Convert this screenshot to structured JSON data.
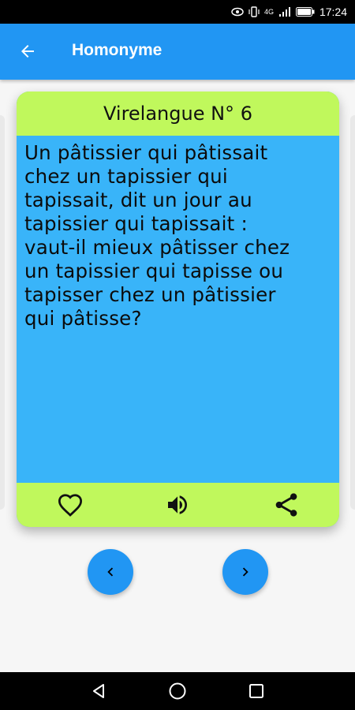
{
  "status_bar": {
    "time": "17:24",
    "network": "4G",
    "icons": [
      "eye-icon",
      "vibrate-icon",
      "signal-icon",
      "battery-icon"
    ]
  },
  "app_bar": {
    "title": "Homonyme",
    "back_icon": "arrow-back-icon"
  },
  "card": {
    "title": "Virelangue N° 6",
    "lines": [
      "Un pâtissier qui pâtissait",
      "chez un tapissier qui",
      "tapissait, dit un jour au",
      "tapissier qui tapissait :",
      "vaut-il mieux pâtisser chez",
      "un tapissier qui tapisse ou",
      "tapisser chez un pâtissier",
      "qui pâtisse?"
    ],
    "actions": [
      "favorite-icon",
      "volume-icon",
      "share-icon"
    ]
  },
  "navigation": {
    "previous_icon": "chevron-left-icon",
    "next_icon": "chevron-right-icon"
  },
  "system_nav": [
    "back-triangle-icon",
    "home-circle-icon",
    "recents-square-icon"
  ],
  "colors": {
    "primary": "#2196f3",
    "card_header": "#c0f85c",
    "card_body": "#39b4f9",
    "background": "#f6f6f6"
  }
}
